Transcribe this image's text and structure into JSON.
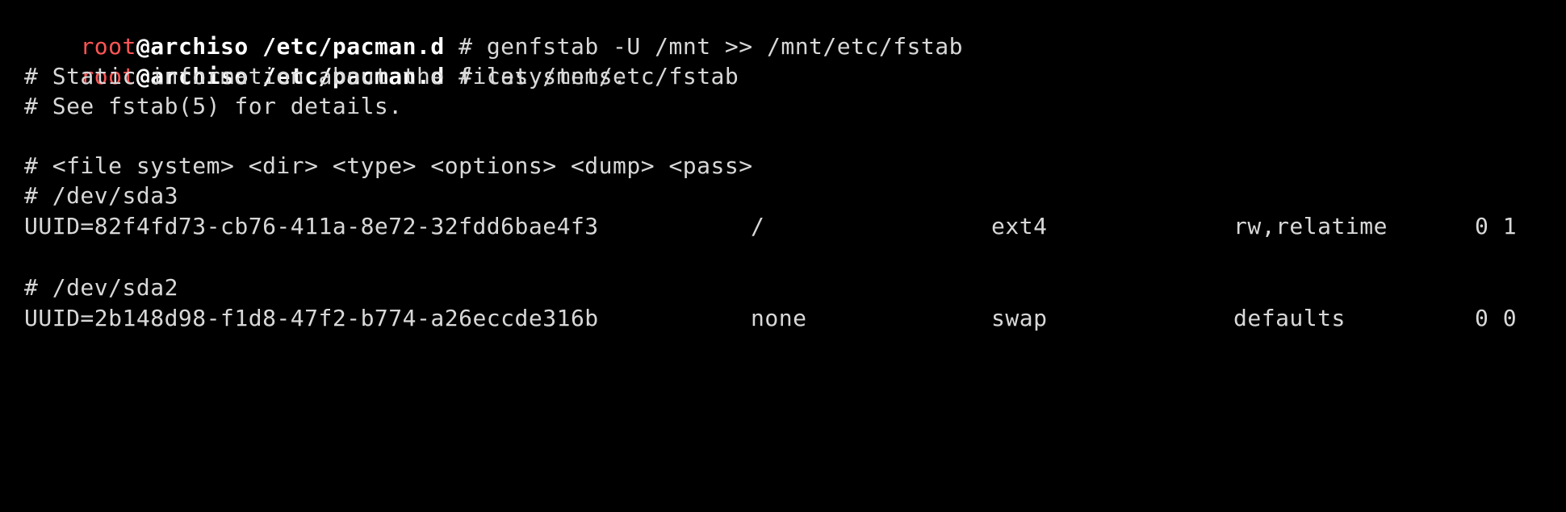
{
  "prompts": [
    {
      "user": "root",
      "host": "@archiso",
      "path": "/etc/pacman.d",
      "symbol": " # ",
      "command": "genfstab -U /mnt >> /mnt/etc/fstab"
    },
    {
      "user": "root",
      "host": "@archiso",
      "path": "/etc/pacman.d",
      "symbol": " # ",
      "command": "cat /mnt/etc/fstab"
    }
  ],
  "output": {
    "comment_1": "# Static information about the filesystems.",
    "comment_2": "# See fstab(5) for details.",
    "header": "# <file system> <dir> <type> <options> <dump> <pass>",
    "entries": [
      {
        "device_comment": "# /dev/sda3",
        "uuid": "UUID=82f4fd73-cb76-411a-8e72-32fdd6bae4f3",
        "dir": "/",
        "type": "ext4",
        "options": "rw,relatime",
        "dump_pass": "0 1"
      },
      {
        "device_comment": "# /dev/sda2",
        "uuid": "UUID=2b148d98-f1d8-47f2-b774-a26eccde316b",
        "dir": "none",
        "type": "swap",
        "options": "defaults",
        "dump_pass": "0 0"
      }
    ]
  },
  "colors": {
    "background": "#000000",
    "text": "#d8d8d8",
    "user": "#ff5555",
    "path": "#ffffff"
  }
}
